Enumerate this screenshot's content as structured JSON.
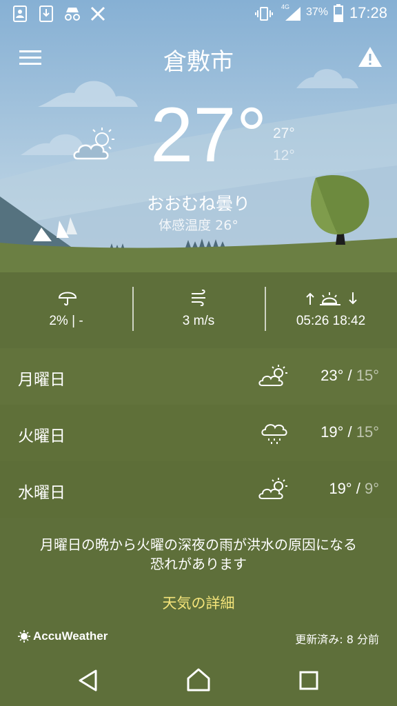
{
  "status_bar": {
    "network": "4G",
    "battery": "37%",
    "time": "17:28"
  },
  "header": {
    "city": "倉敷市",
    "menu_icon": "menu-icon",
    "alert_icon": "warning-icon"
  },
  "current": {
    "temperature": "27°",
    "high": "27°",
    "low": "12°",
    "condition": "おおむね曇り",
    "feels_like": "体感温度 26°",
    "icon": "partly-cloudy-icon"
  },
  "stats": {
    "precipitation": "2% | -",
    "wind": "3 m/s",
    "sunrise_sunset": "05:26  18:42"
  },
  "forecast": [
    {
      "day": "月曜日",
      "high": "23°",
      "low": "15°",
      "icon": "partly-cloudy-icon"
    },
    {
      "day": "火曜日",
      "high": "19°",
      "low": "15°",
      "icon": "rain-cloud-icon"
    },
    {
      "day": "水曜日",
      "high": "19°",
      "low": "9°",
      "icon": "partly-cloudy-icon"
    }
  ],
  "alert": {
    "line1": "月曜日の晩から火曜の深夜の雨が洪水の原因になる",
    "line2": "恐れがあります"
  },
  "details_link": "天気の詳細",
  "footer": {
    "brand": "AccuWeather",
    "updated": "更新済み: 8 分前"
  },
  "colors": {
    "sky_top": "#8cb4d6",
    "sky_bottom": "#c5d9e6",
    "grass": "#5b6c38",
    "tree": "#6d8a3e",
    "link": "#f4e47a"
  }
}
